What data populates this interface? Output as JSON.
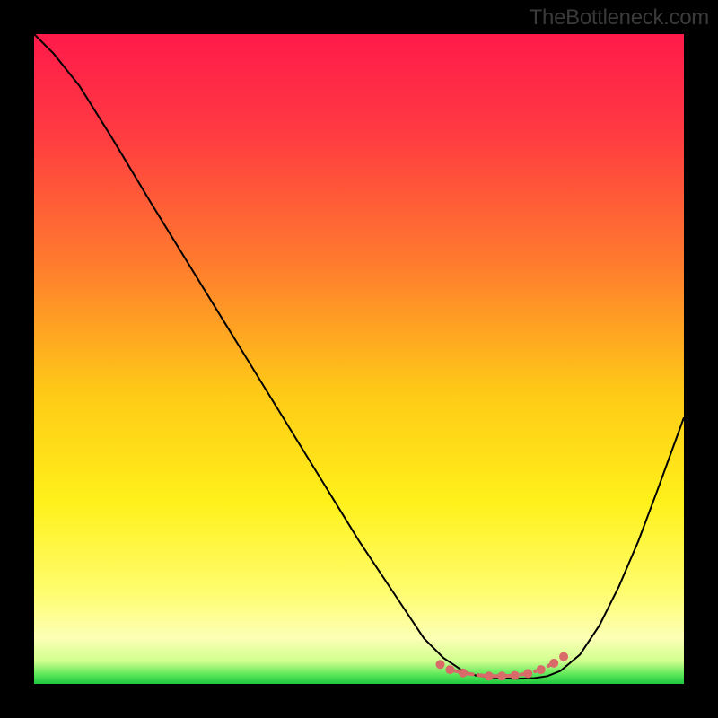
{
  "watermark": "TheBottleneck.com",
  "chart_data": {
    "type": "line",
    "title": "",
    "xlabel": "",
    "ylabel": "",
    "xlim": [
      0,
      100
    ],
    "ylim": [
      0,
      100
    ],
    "grid": false,
    "background_gradient": {
      "description": "vertical gradient from red-pink at top through orange/yellow to green at bottom",
      "stops": [
        {
          "pos": 0.0,
          "color": "#ff1a4a"
        },
        {
          "pos": 0.15,
          "color": "#ff3a42"
        },
        {
          "pos": 0.35,
          "color": "#ff7a2e"
        },
        {
          "pos": 0.55,
          "color": "#ffc917"
        },
        {
          "pos": 0.72,
          "color": "#fff11a"
        },
        {
          "pos": 0.86,
          "color": "#fffd70"
        },
        {
          "pos": 0.93,
          "color": "#fcffb5"
        },
        {
          "pos": 0.965,
          "color": "#d1ff8f"
        },
        {
          "pos": 0.985,
          "color": "#5fe85a"
        },
        {
          "pos": 1.0,
          "color": "#1dc63e"
        }
      ]
    },
    "series": [
      {
        "name": "bottleneck-curve",
        "color": "#000000",
        "stroke_width": 2,
        "x": [
          0.0,
          3.0,
          7.0,
          12.0,
          18.0,
          26.0,
          34.0,
          42.0,
          50.0,
          56.0,
          60.0,
          63.0,
          66.0,
          68.0,
          71.0,
          74.0,
          77.0,
          79.0,
          81.0,
          84.0,
          87.0,
          90.0,
          93.0,
          96.0,
          100.0
        ],
        "y": [
          100.0,
          97.0,
          92.0,
          84.0,
          74.0,
          61.0,
          48.0,
          35.0,
          22.0,
          13.0,
          7.0,
          4.0,
          2.0,
          1.3,
          0.9,
          0.8,
          0.9,
          1.2,
          2.0,
          4.5,
          9.0,
          15.0,
          22.0,
          30.0,
          41.0
        ]
      },
      {
        "name": "valley-markers",
        "type": "scatter",
        "color": "#d86a6a",
        "marker_radius": 5,
        "x": [
          62.5,
          64.0,
          66.0,
          70.0,
          72.0,
          74.0,
          76.0,
          78.0,
          80.0,
          81.5
        ],
        "y": [
          3.0,
          2.2,
          1.7,
          1.2,
          1.2,
          1.3,
          1.6,
          2.2,
          3.2,
          4.2
        ]
      },
      {
        "name": "valley-connector",
        "type": "line",
        "color": "#d86a6a",
        "stroke_width": 4,
        "dash": "10,6",
        "x": [
          64.0,
          66.0,
          68.0,
          70.0,
          72.0,
          74.0,
          76.0,
          78.0,
          80.0
        ],
        "y": [
          2.2,
          1.7,
          1.4,
          1.2,
          1.2,
          1.3,
          1.6,
          2.2,
          3.2
        ]
      }
    ]
  }
}
